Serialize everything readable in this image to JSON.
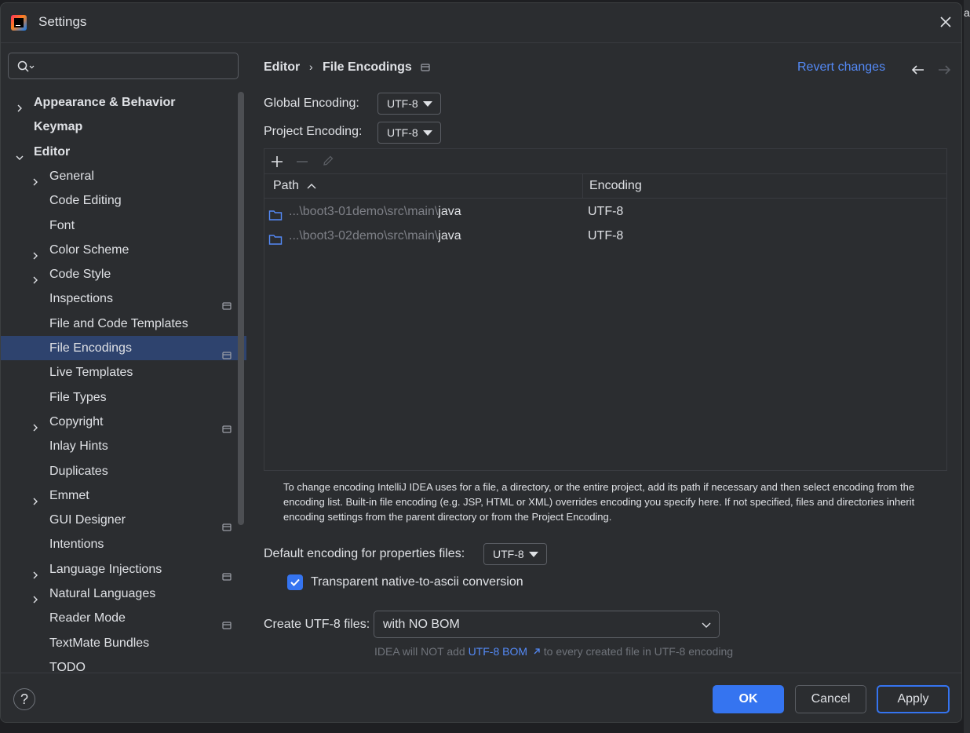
{
  "window": {
    "title": "Settings",
    "background_edge_text": "a"
  },
  "search": {
    "placeholder": ""
  },
  "sidebar": {
    "items": [
      {
        "label": "Appearance & Behavior",
        "indent": 0,
        "chevron": "right",
        "bold": true,
        "project": false
      },
      {
        "label": "Keymap",
        "indent": 0,
        "chevron": "none",
        "bold": true,
        "project": false
      },
      {
        "label": "Editor",
        "indent": 0,
        "chevron": "down",
        "bold": true,
        "project": false
      },
      {
        "label": "General",
        "indent": 1,
        "chevron": "right",
        "bold": false,
        "project": false
      },
      {
        "label": "Code Editing",
        "indent": 1,
        "chevron": "none",
        "bold": false,
        "project": false
      },
      {
        "label": "Font",
        "indent": 1,
        "chevron": "none",
        "bold": false,
        "project": false
      },
      {
        "label": "Color Scheme",
        "indent": 1,
        "chevron": "right",
        "bold": false,
        "project": false
      },
      {
        "label": "Code Style",
        "indent": 1,
        "chevron": "right",
        "bold": false,
        "project": false
      },
      {
        "label": "Inspections",
        "indent": 1,
        "chevron": "none",
        "bold": false,
        "project": true
      },
      {
        "label": "File and Code Templates",
        "indent": 1,
        "chevron": "none",
        "bold": false,
        "project": false
      },
      {
        "label": "File Encodings",
        "indent": 1,
        "chevron": "none",
        "bold": false,
        "project": true,
        "selected": true
      },
      {
        "label": "Live Templates",
        "indent": 1,
        "chevron": "none",
        "bold": false,
        "project": false
      },
      {
        "label": "File Types",
        "indent": 1,
        "chevron": "none",
        "bold": false,
        "project": false
      },
      {
        "label": "Copyright",
        "indent": 1,
        "chevron": "right",
        "bold": false,
        "project": true
      },
      {
        "label": "Inlay Hints",
        "indent": 1,
        "chevron": "none",
        "bold": false,
        "project": false
      },
      {
        "label": "Duplicates",
        "indent": 1,
        "chevron": "none",
        "bold": false,
        "project": false
      },
      {
        "label": "Emmet",
        "indent": 1,
        "chevron": "right",
        "bold": false,
        "project": false
      },
      {
        "label": "GUI Designer",
        "indent": 1,
        "chevron": "none",
        "bold": false,
        "project": true
      },
      {
        "label": "Intentions",
        "indent": 1,
        "chevron": "none",
        "bold": false,
        "project": false
      },
      {
        "label": "Language Injections",
        "indent": 1,
        "chevron": "right",
        "bold": false,
        "project": true
      },
      {
        "label": "Natural Languages",
        "indent": 1,
        "chevron": "right",
        "bold": false,
        "project": false
      },
      {
        "label": "Reader Mode",
        "indent": 1,
        "chevron": "none",
        "bold": false,
        "project": true
      },
      {
        "label": "TextMate Bundles",
        "indent": 1,
        "chevron": "none",
        "bold": false,
        "project": false
      },
      {
        "label": "TODO",
        "indent": 1,
        "chevron": "none",
        "bold": false,
        "project": false
      }
    ]
  },
  "header": {
    "breadcrumb_parent": "Editor",
    "breadcrumb_separator": "›",
    "breadcrumb_current": "File Encodings",
    "revert_label": "Revert changes"
  },
  "encodings": {
    "global_label": "Global Encoding:",
    "global_value": "UTF-8",
    "project_label": "Project Encoding:",
    "project_value": "UTF-8"
  },
  "table": {
    "columns": [
      "Path",
      "Encoding"
    ],
    "rows": [
      {
        "path_prefix": "...\\boot3-01demo\\src\\main\\",
        "path_leaf": "java",
        "encoding": "UTF-8"
      },
      {
        "path_prefix": "...\\boot3-02demo\\src\\main\\",
        "path_leaf": "java",
        "encoding": "UTF-8"
      }
    ]
  },
  "help_text": "To change encoding IntelliJ IDEA uses for a file, a directory, or the entire project, add its path if necessary and then select encoding from the encoding list. Built-in file encoding (e.g. JSP, HTML or XML) overrides encoding you specify here. If not specified, files and directories inherit encoding settings from the parent directory or from the Project Encoding.",
  "properties": {
    "label": "Default encoding for properties files:",
    "value": "UTF-8",
    "native_to_ascii_label": "Transparent native-to-ascii conversion",
    "native_to_ascii_checked": true
  },
  "bom": {
    "label": "Create UTF-8 files:",
    "value": "with NO BOM",
    "hint_before": "IDEA will NOT add ",
    "hint_link": "UTF-8 BOM",
    "hint_after": " to every created file in UTF-8 encoding"
  },
  "footer": {
    "help_label": "?",
    "ok_label": "OK",
    "cancel_label": "Cancel",
    "apply_label": "Apply"
  },
  "colors": {
    "accent": "#3574f0",
    "link": "#548af7",
    "selection": "#2e436e",
    "background": "#2b2d30"
  }
}
